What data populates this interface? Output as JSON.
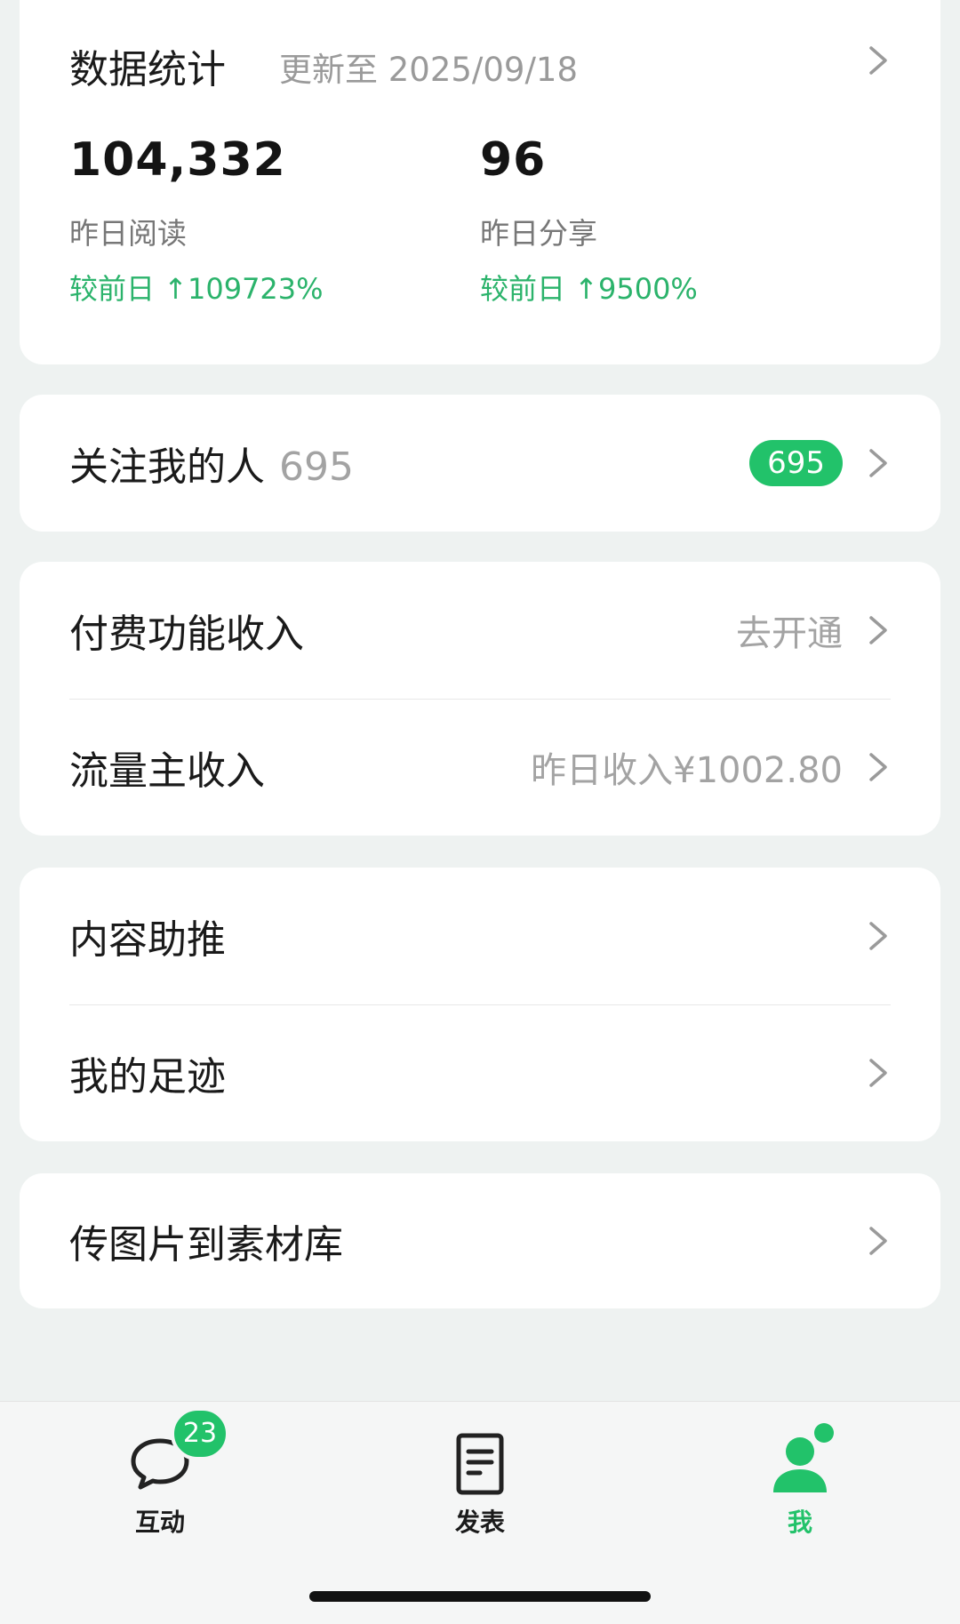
{
  "stats": {
    "title": "数据统计",
    "updated": "更新至 2025/09/18",
    "reads": {
      "value": "104,332",
      "label": "昨日阅读",
      "change": "较前日 ↑109723%"
    },
    "shares": {
      "value": "96",
      "label": "昨日分享",
      "change": "较前日 ↑9500%"
    }
  },
  "followers": {
    "label": "关注我的人",
    "count": "695",
    "badge": "695"
  },
  "income": {
    "paid": {
      "label": "付费功能收入",
      "action": "去开通"
    },
    "ads": {
      "label": "流量主收入",
      "detail": "昨日收入¥1002.80"
    }
  },
  "tools": {
    "promote": {
      "label": "内容助推"
    },
    "footprint": {
      "label": "我的足迹"
    }
  },
  "upload": {
    "label": "传图片到素材库"
  },
  "tabbar": {
    "interact": {
      "label": "互动",
      "badge": "23"
    },
    "publish": {
      "label": "发表"
    },
    "me": {
      "label": "我"
    }
  },
  "colors": {
    "accent": "#22c26a",
    "muted": "#a3a3a3",
    "background": "#eef2f1"
  },
  "icons": [
    "chevron-right-icon",
    "chat-bubble-icon",
    "document-icon",
    "person-icon"
  ]
}
